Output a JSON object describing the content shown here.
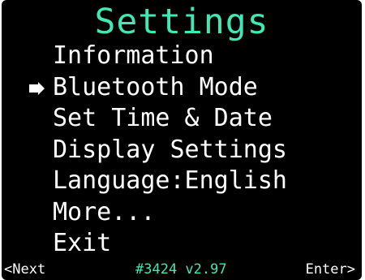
{
  "screen": {
    "title": "Settings"
  },
  "menu": {
    "items": [
      {
        "label": "Information",
        "selected": false
      },
      {
        "label": "Bluetooth Mode",
        "selected": true
      },
      {
        "label": "Set Time & Date",
        "selected": false
      },
      {
        "label": "Display Settings",
        "selected": false
      },
      {
        "label": "Language:English",
        "selected": false
      },
      {
        "label": "More...",
        "selected": false
      },
      {
        "label": "Exit",
        "selected": false
      }
    ],
    "cursor_icon": "arrow-right-icon"
  },
  "footer": {
    "left": "<Next",
    "center": "#3424 v2.97",
    "right": "Enter>"
  },
  "colors": {
    "background": "#000000",
    "accent": "#3fe8b4",
    "text": "#ffffff"
  }
}
